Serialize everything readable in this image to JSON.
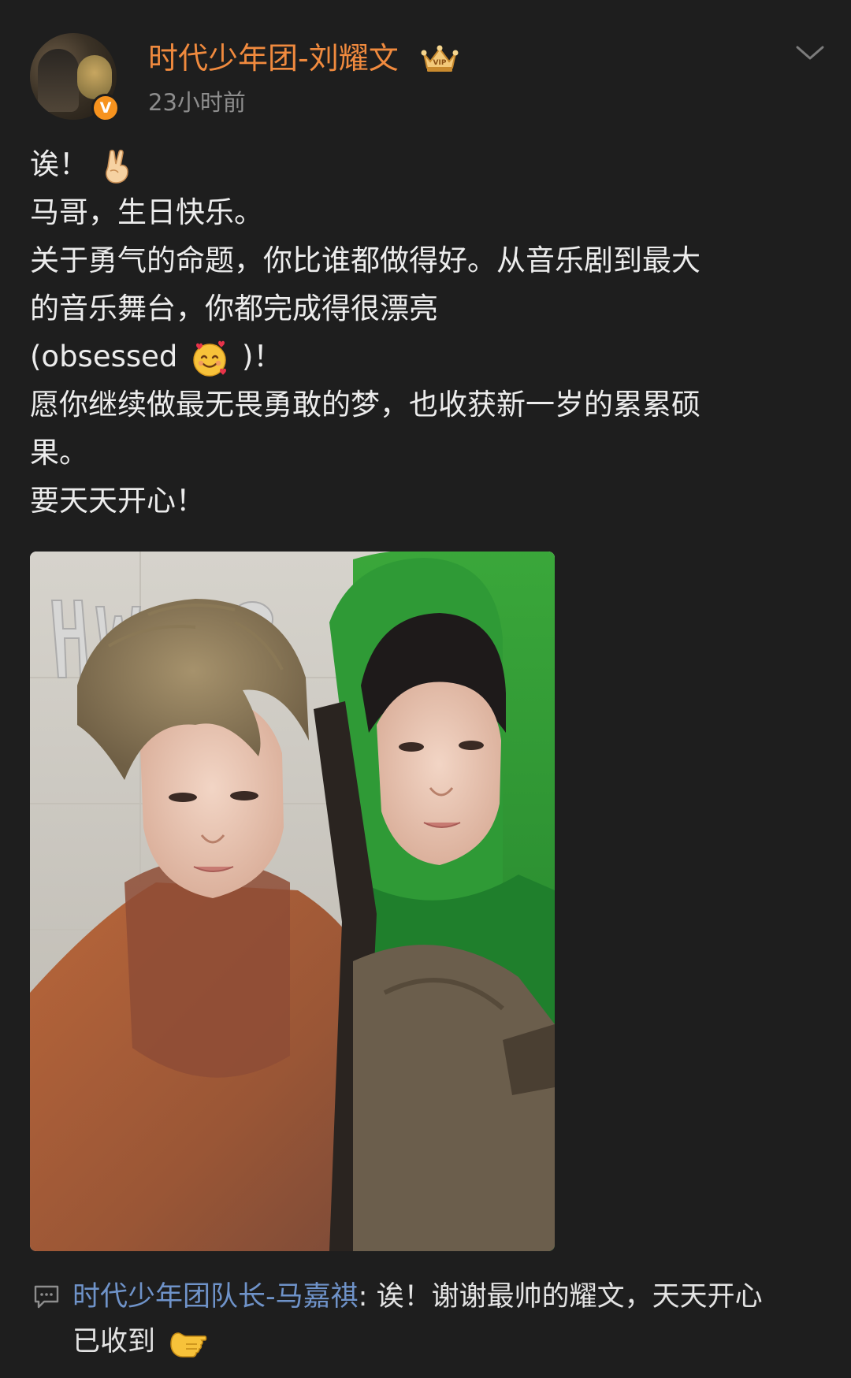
{
  "post": {
    "author": {
      "name": "时代少年团-刘耀文",
      "verified_badge": "V",
      "badge_color": "#f7931e",
      "name_color": "#f08a3e",
      "crown_icon": "crown-icon"
    },
    "timestamp": "23小时前",
    "lines": {
      "l1": "诶！",
      "l2": "马哥，生日快乐。",
      "l3": "关于勇气的命题，你比谁都做得好。从音乐剧到最大",
      "l4": "的音乐舞台，你都完成得很漂亮",
      "l5_before": "(obsessed ",
      "l5_after": ")！",
      "l6": "愿你继续做最无畏勇敢的梦，也收获新一岁的累累硕",
      "l7": "果。",
      "l8": "要天天开心！"
    },
    "emojis": {
      "after_l1": "victory-hand-emoji",
      "in_l5": "smiling-face-with-hearts-emoji"
    },
    "photo": {
      "subject": "two-people-selfie-in-costumes"
    }
  },
  "comment": {
    "author": "时代少年团队长-马嘉祺",
    "separator": ": ",
    "text_l1": "诶！谢谢最帅的耀文，天天开心",
    "text_l2": "已收到",
    "author_color": "#6f93c9",
    "emoji": "pointing-hand-emoji"
  },
  "colors": {
    "background": "#1e1e1e",
    "text": "#ececec",
    "muted": "#8d8d8d"
  }
}
